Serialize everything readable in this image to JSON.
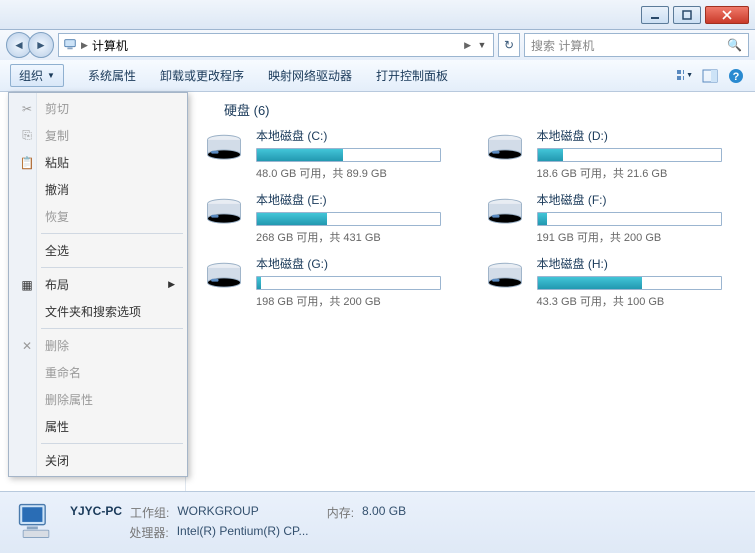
{
  "address": {
    "path": "计算机",
    "separator": "▶"
  },
  "search": {
    "placeholder": "搜索 计算机"
  },
  "toolbar": {
    "organize": "组织",
    "items": [
      "系统属性",
      "卸载或更改程序",
      "映射网络驱动器",
      "打开控制面板"
    ]
  },
  "menu": {
    "cut": "剪切",
    "copy": "复制",
    "paste": "粘贴",
    "undo": "撤消",
    "redo": "恢复",
    "selectall": "全选",
    "layout": "布局",
    "folderopts": "文件夹和搜索选项",
    "delete": "删除",
    "rename": "重命名",
    "removeprops": "删除属性",
    "properties": "属性",
    "close": "关闭"
  },
  "section": {
    "header": "硬盘 (6)"
  },
  "drives": [
    {
      "name": "本地磁盘 (C:)",
      "stat": "48.0 GB 可用，共 89.9 GB",
      "pct": 47
    },
    {
      "name": "本地磁盘 (D:)",
      "stat": "18.6 GB 可用，共 21.6 GB",
      "pct": 14
    },
    {
      "name": "本地磁盘 (E:)",
      "stat": "268 GB 可用，共 431 GB",
      "pct": 38
    },
    {
      "name": "本地磁盘 (F:)",
      "stat": "191 GB 可用，共 200 GB",
      "pct": 5
    },
    {
      "name": "本地磁盘 (G:)",
      "stat": "198 GB 可用，共 200 GB",
      "pct": 2
    },
    {
      "name": "本地磁盘 (H:)",
      "stat": "43.3 GB 可用，共 100 GB",
      "pct": 57
    }
  ],
  "sidebar": {
    "network_pc": "YJYC-PC"
  },
  "status": {
    "name": "YJYC-PC",
    "workgroup_label": "工作组:",
    "workgroup": "WORKGROUP",
    "proc_label": "处理器:",
    "proc": "Intel(R) Pentium(R) CP...",
    "mem_label": "内存:",
    "mem": "8.00 GB"
  }
}
